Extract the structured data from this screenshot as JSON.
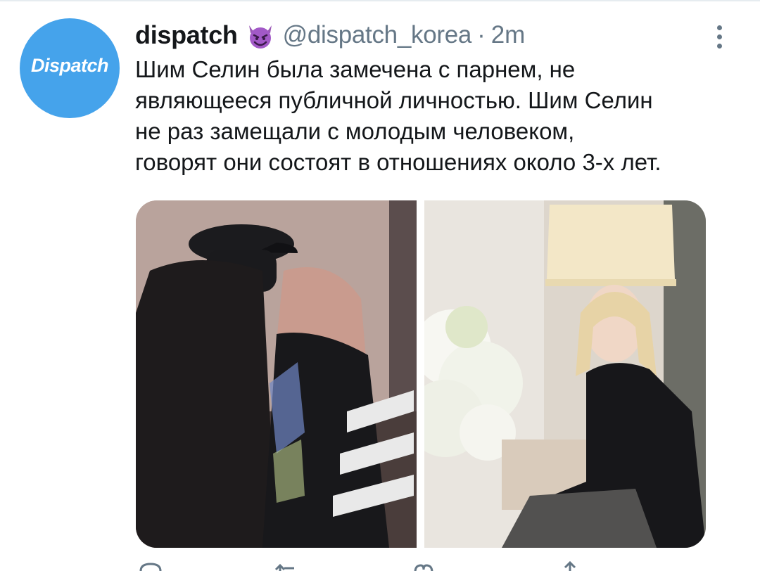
{
  "tweet": {
    "author": {
      "display_name": "dispatch",
      "handle": "@dispatch_korea",
      "avatar_text": "Dispatch",
      "badge_icon": "smiling-devil-emoji-icon"
    },
    "separator": "·",
    "timestamp": "2m",
    "text_lines": [
      "Шим Селин была замечена с парнем, не",
      "являющееся публичной личностью. Шим Селин",
      "не раз замещали с молодым человеком,",
      "говорят они состоят в отношениях около 3-х лет."
    ],
    "media": [
      {
        "name": "photo-couple-street",
        "description": "person in black cap and mask with woman with pink hair"
      },
      {
        "name": "photo-woman-flowers",
        "description": "blonde woman seated beside white flowers and lamp"
      }
    ]
  },
  "actions": [
    {
      "name": "reply-icon"
    },
    {
      "name": "retweet-icon"
    },
    {
      "name": "like-icon"
    },
    {
      "name": "share-icon"
    }
  ],
  "colors": {
    "avatar_bg": "#45a3eb",
    "text_primary": "#14171a",
    "text_secondary": "#657786",
    "divider": "#e6ecf0"
  }
}
